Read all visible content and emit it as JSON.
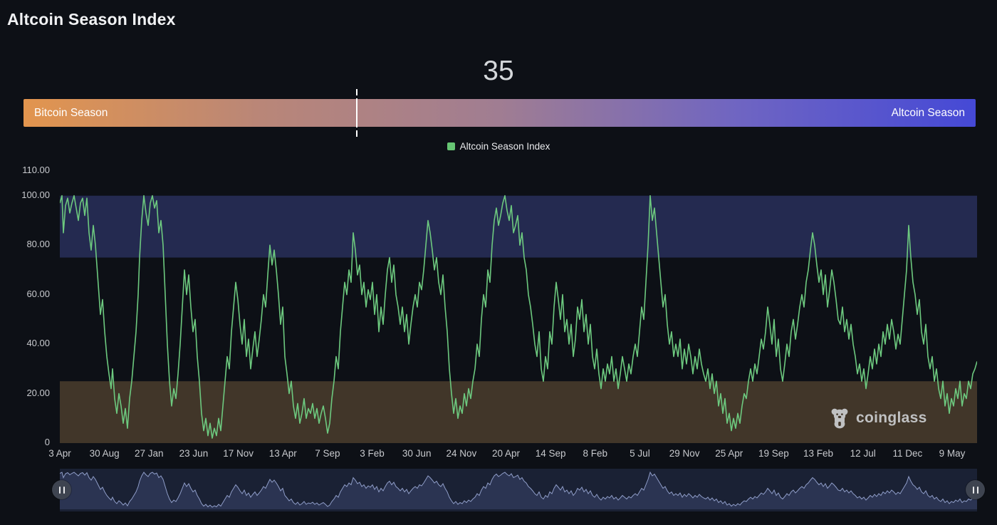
{
  "page": {
    "title": "Altcoin Season Index",
    "background": "#0d1016"
  },
  "index_display": {
    "value": "35"
  },
  "season_bar": {
    "left_label": "Bitcoin Season",
    "right_label": "Altcoin Season",
    "marker_percent": 35,
    "gradient_stops": [
      "#e2954e",
      "#b98678",
      "#a07d92",
      "#6f65c2",
      "#4549d6"
    ]
  },
  "legend": {
    "label": "Altcoin Season Index",
    "swatch_color": "#66c573"
  },
  "watermark": {
    "label": "coinglass",
    "icon": "coinglass-bear-logo",
    "color": "#cbcdd0"
  },
  "navigator": {
    "background": "#1a2134",
    "area_fill": "#2b3452",
    "line_color": "#8f9dc8",
    "left_handle_icon": "pause-grip-icon",
    "right_handle_icon": "pause-grip-icon"
  },
  "chart_data": {
    "type": "line",
    "title": "Altcoin Season Index",
    "series": [
      {
        "name": "Altcoin Season Index",
        "color": "#6dc97f"
      }
    ],
    "ylim": [
      0,
      110
    ],
    "grid": false,
    "legend_position": "top-center",
    "y_ticks": [
      {
        "label": "110.00",
        "value": 110
      },
      {
        "label": "100.00",
        "value": 100
      },
      {
        "label": "80.00",
        "value": 80
      },
      {
        "label": "60.00",
        "value": 60
      },
      {
        "label": "40.00",
        "value": 40
      },
      {
        "label": "20.00",
        "value": 20
      },
      {
        "label": "0",
        "value": 0
      }
    ],
    "x_labels": [
      "3 Apr",
      "30 Aug",
      "27 Jan",
      "23 Jun",
      "17 Nov",
      "13 Apr",
      "7 Sep",
      "3 Feb",
      "30 Jun",
      "24 Nov",
      "20 Apr",
      "14 Sep",
      "8 Feb",
      "5 Jul",
      "29 Nov",
      "25 Apr",
      "19 Sep",
      "13 Feb",
      "12 Jul",
      "11 Dec",
      "9 May"
    ],
    "bands": [
      {
        "name": "altcoin-season-zone",
        "from": 75,
        "to": 100,
        "color": "#242a50"
      },
      {
        "name": "bitcoin-season-zone",
        "from": 0,
        "to": 25,
        "color": "#413629"
      }
    ],
    "points": [
      [
        84,
        97
      ],
      [
        87,
        100
      ],
      [
        89,
        85
      ],
      [
        92,
        96
      ],
      [
        95,
        99
      ],
      [
        98,
        93
      ],
      [
        101,
        97
      ],
      [
        104,
        100
      ],
      [
        107,
        95
      ],
      [
        110,
        90
      ],
      [
        113,
        97
      ],
      [
        116,
        99
      ],
      [
        119,
        92
      ],
      [
        122,
        99
      ],
      [
        125,
        85
      ],
      [
        128,
        78
      ],
      [
        131,
        88
      ],
      [
        134,
        80
      ],
      [
        136,
        72
      ],
      [
        139,
        60
      ],
      [
        141,
        52
      ],
      [
        144,
        58
      ],
      [
        147,
        45
      ],
      [
        150,
        35
      ],
      [
        153,
        28
      ],
      [
        156,
        22
      ],
      [
        158,
        30
      ],
      [
        161,
        18
      ],
      [
        164,
        12
      ],
      [
        167,
        20
      ],
      [
        170,
        15
      ],
      [
        173,
        8
      ],
      [
        176,
        14
      ],
      [
        179,
        6
      ],
      [
        182,
        18
      ],
      [
        185,
        25
      ],
      [
        188,
        35
      ],
      [
        191,
        45
      ],
      [
        194,
        60
      ],
      [
        196,
        75
      ],
      [
        199,
        90
      ],
      [
        202,
        100
      ],
      [
        205,
        93
      ],
      [
        208,
        88
      ],
      [
        211,
        97
      ],
      [
        214,
        100
      ],
      [
        217,
        95
      ],
      [
        220,
        98
      ],
      [
        223,
        85
      ],
      [
        226,
        90
      ],
      [
        229,
        80
      ],
      [
        232,
        60
      ],
      [
        235,
        40
      ],
      [
        238,
        25
      ],
      [
        241,
        15
      ],
      [
        244,
        22
      ],
      [
        247,
        18
      ],
      [
        250,
        28
      ],
      [
        253,
        40
      ],
      [
        256,
        55
      ],
      [
        259,
        70
      ],
      [
        262,
        60
      ],
      [
        265,
        68
      ],
      [
        268,
        55
      ],
      [
        271,
        45
      ],
      [
        274,
        50
      ],
      [
        277,
        35
      ],
      [
        280,
        25
      ],
      [
        283,
        12
      ],
      [
        286,
        5
      ],
      [
        289,
        10
      ],
      [
        292,
        3
      ],
      [
        295,
        8
      ],
      [
        298,
        2
      ],
      [
        301,
        6
      ],
      [
        304,
        3
      ],
      [
        307,
        10
      ],
      [
        310,
        5
      ],
      [
        313,
        15
      ],
      [
        316,
        25
      ],
      [
        319,
        35
      ],
      [
        322,
        30
      ],
      [
        325,
        45
      ],
      [
        328,
        55
      ],
      [
        331,
        65
      ],
      [
        334,
        58
      ],
      [
        337,
        48
      ],
      [
        340,
        40
      ],
      [
        343,
        50
      ],
      [
        346,
        35
      ],
      [
        349,
        42
      ],
      [
        352,
        30
      ],
      [
        355,
        38
      ],
      [
        358,
        45
      ],
      [
        361,
        35
      ],
      [
        364,
        42
      ],
      [
        367,
        50
      ],
      [
        370,
        60
      ],
      [
        373,
        55
      ],
      [
        376,
        68
      ],
      [
        379,
        80
      ],
      [
        382,
        72
      ],
      [
        385,
        78
      ],
      [
        388,
        70
      ],
      [
        391,
        60
      ],
      [
        394,
        48
      ],
      [
        397,
        55
      ],
      [
        400,
        35
      ],
      [
        403,
        28
      ],
      [
        406,
        20
      ],
      [
        409,
        25
      ],
      [
        412,
        15
      ],
      [
        415,
        10
      ],
      [
        418,
        16
      ],
      [
        421,
        8
      ],
      [
        424,
        12
      ],
      [
        427,
        18
      ],
      [
        430,
        10
      ],
      [
        433,
        14
      ],
      [
        436,
        12
      ],
      [
        439,
        16
      ],
      [
        442,
        10
      ],
      [
        445,
        14
      ],
      [
        448,
        8
      ],
      [
        451,
        12
      ],
      [
        454,
        15
      ],
      [
        457,
        10
      ],
      [
        460,
        4
      ],
      [
        463,
        8
      ],
      [
        466,
        18
      ],
      [
        469,
        25
      ],
      [
        472,
        35
      ],
      [
        475,
        30
      ],
      [
        478,
        45
      ],
      [
        481,
        55
      ],
      [
        484,
        65
      ],
      [
        487,
        60
      ],
      [
        490,
        70
      ],
      [
        493,
        65
      ],
      [
        496,
        85
      ],
      [
        499,
        78
      ],
      [
        502,
        68
      ],
      [
        505,
        72
      ],
      [
        508,
        60
      ],
      [
        511,
        65
      ],
      [
        514,
        55
      ],
      [
        517,
        62
      ],
      [
        520,
        58
      ],
      [
        523,
        65
      ],
      [
        526,
        52
      ],
      [
        529,
        60
      ],
      [
        532,
        45
      ],
      [
        535,
        55
      ],
      [
        538,
        48
      ],
      [
        541,
        60
      ],
      [
        544,
        70
      ],
      [
        547,
        75
      ],
      [
        550,
        65
      ],
      [
        553,
        72
      ],
      [
        556,
        60
      ],
      [
        559,
        55
      ],
      [
        562,
        48
      ],
      [
        565,
        55
      ],
      [
        568,
        45
      ],
      [
        571,
        52
      ],
      [
        574,
        40
      ],
      [
        577,
        48
      ],
      [
        580,
        55
      ],
      [
        583,
        60
      ],
      [
        586,
        55
      ],
      [
        589,
        65
      ],
      [
        592,
        62
      ],
      [
        595,
        70
      ],
      [
        598,
        80
      ],
      [
        601,
        90
      ],
      [
        604,
        85
      ],
      [
        607,
        78
      ],
      [
        610,
        70
      ],
      [
        613,
        75
      ],
      [
        616,
        65
      ],
      [
        619,
        60
      ],
      [
        622,
        68
      ],
      [
        625,
        55
      ],
      [
        628,
        45
      ],
      [
        631,
        30
      ],
      [
        634,
        20
      ],
      [
        637,
        12
      ],
      [
        640,
        18
      ],
      [
        643,
        10
      ],
      [
        646,
        15
      ],
      [
        649,
        12
      ],
      [
        652,
        20
      ],
      [
        655,
        15
      ],
      [
        658,
        22
      ],
      [
        661,
        18
      ],
      [
        664,
        25
      ],
      [
        667,
        30
      ],
      [
        670,
        40
      ],
      [
        673,
        35
      ],
      [
        676,
        50
      ],
      [
        679,
        60
      ],
      [
        682,
        55
      ],
      [
        685,
        70
      ],
      [
        688,
        65
      ],
      [
        691,
        80
      ],
      [
        694,
        90
      ],
      [
        697,
        95
      ],
      [
        700,
        88
      ],
      [
        703,
        92
      ],
      [
        706,
        97
      ],
      [
        709,
        100
      ],
      [
        712,
        94
      ],
      [
        715,
        90
      ],
      [
        718,
        96
      ],
      [
        721,
        85
      ],
      [
        724,
        88
      ],
      [
        727,
        92
      ],
      [
        730,
        80
      ],
      [
        733,
        85
      ],
      [
        736,
        75
      ],
      [
        739,
        70
      ],
      [
        742,
        60
      ],
      [
        745,
        55
      ],
      [
        748,
        48
      ],
      [
        751,
        40
      ],
      [
        754,
        35
      ],
      [
        757,
        45
      ],
      [
        760,
        30
      ],
      [
        763,
        25
      ],
      [
        766,
        35
      ],
      [
        769,
        30
      ],
      [
        772,
        45
      ],
      [
        775,
        40
      ],
      [
        778,
        55
      ],
      [
        781,
        65
      ],
      [
        784,
        58
      ],
      [
        787,
        50
      ],
      [
        790,
        60
      ],
      [
        793,
        45
      ],
      [
        796,
        50
      ],
      [
        799,
        40
      ],
      [
        802,
        48
      ],
      [
        805,
        35
      ],
      [
        808,
        42
      ],
      [
        811,
        55
      ],
      [
        814,
        50
      ],
      [
        817,
        58
      ],
      [
        820,
        45
      ],
      [
        823,
        52
      ],
      [
        826,
        40
      ],
      [
        829,
        48
      ],
      [
        832,
        35
      ],
      [
        835,
        30
      ],
      [
        838,
        38
      ],
      [
        841,
        28
      ],
      [
        844,
        22
      ],
      [
        847,
        30
      ],
      [
        850,
        25
      ],
      [
        853,
        32
      ],
      [
        856,
        28
      ],
      [
        859,
        35
      ],
      [
        862,
        25
      ],
      [
        865,
        30
      ],
      [
        868,
        22
      ],
      [
        871,
        28
      ],
      [
        874,
        35
      ],
      [
        877,
        30
      ],
      [
        880,
        25
      ],
      [
        883,
        32
      ],
      [
        886,
        28
      ],
      [
        889,
        35
      ],
      [
        892,
        40
      ],
      [
        895,
        35
      ],
      [
        898,
        45
      ],
      [
        901,
        55
      ],
      [
        904,
        50
      ],
      [
        907,
        65
      ],
      [
        910,
        80
      ],
      [
        913,
        100
      ],
      [
        916,
        90
      ],
      [
        919,
        95
      ],
      [
        922,
        85
      ],
      [
        925,
        75
      ],
      [
        928,
        65
      ],
      [
        931,
        55
      ],
      [
        934,
        60
      ],
      [
        937,
        48
      ],
      [
        940,
        40
      ],
      [
        943,
        45
      ],
      [
        946,
        35
      ],
      [
        949,
        40
      ],
      [
        952,
        35
      ],
      [
        955,
        42
      ],
      [
        958,
        30
      ],
      [
        961,
        38
      ],
      [
        964,
        32
      ],
      [
        967,
        40
      ],
      [
        970,
        35
      ],
      [
        973,
        28
      ],
      [
        976,
        35
      ],
      [
        979,
        30
      ],
      [
        982,
        38
      ],
      [
        985,
        32
      ],
      [
        988,
        28
      ],
      [
        991,
        25
      ],
      [
        994,
        30
      ],
      [
        997,
        22
      ],
      [
        1000,
        28
      ],
      [
        1003,
        20
      ],
      [
        1006,
        25
      ],
      [
        1009,
        15
      ],
      [
        1012,
        20
      ],
      [
        1015,
        12
      ],
      [
        1018,
        18
      ],
      [
        1021,
        8
      ],
      [
        1024,
        12
      ],
      [
        1027,
        5
      ],
      [
        1030,
        10
      ],
      [
        1033,
        6
      ],
      [
        1036,
        12
      ],
      [
        1039,
        8
      ],
      [
        1042,
        15
      ],
      [
        1045,
        20
      ],
      [
        1048,
        18
      ],
      [
        1051,
        25
      ],
      [
        1054,
        30
      ],
      [
        1057,
        25
      ],
      [
        1060,
        32
      ],
      [
        1063,
        28
      ],
      [
        1066,
        35
      ],
      [
        1069,
        42
      ],
      [
        1072,
        38
      ],
      [
        1075,
        45
      ],
      [
        1078,
        55
      ],
      [
        1081,
        48
      ],
      [
        1084,
        40
      ],
      [
        1087,
        50
      ],
      [
        1090,
        35
      ],
      [
        1093,
        42
      ],
      [
        1096,
        30
      ],
      [
        1099,
        25
      ],
      [
        1102,
        32
      ],
      [
        1105,
        40
      ],
      [
        1108,
        35
      ],
      [
        1111,
        45
      ],
      [
        1114,
        50
      ],
      [
        1117,
        42
      ],
      [
        1120,
        48
      ],
      [
        1123,
        55
      ],
      [
        1126,
        60
      ],
      [
        1129,
        55
      ],
      [
        1132,
        65
      ],
      [
        1135,
        70
      ],
      [
        1138,
        78
      ],
      [
        1141,
        85
      ],
      [
        1144,
        80
      ],
      [
        1147,
        72
      ],
      [
        1150,
        65
      ],
      [
        1153,
        70
      ],
      [
        1156,
        60
      ],
      [
        1159,
        68
      ],
      [
        1162,
        55
      ],
      [
        1165,
        62
      ],
      [
        1168,
        70
      ],
      [
        1171,
        65
      ],
      [
        1174,
        58
      ],
      [
        1177,
        50
      ],
      [
        1180,
        48
      ],
      [
        1183,
        55
      ],
      [
        1186,
        45
      ],
      [
        1189,
        50
      ],
      [
        1192,
        42
      ],
      [
        1195,
        48
      ],
      [
        1198,
        40
      ],
      [
        1201,
        35
      ],
      [
        1204,
        28
      ],
      [
        1207,
        32
      ],
      [
        1210,
        25
      ],
      [
        1213,
        30
      ],
      [
        1216,
        22
      ],
      [
        1219,
        28
      ],
      [
        1222,
        35
      ],
      [
        1225,
        30
      ],
      [
        1228,
        38
      ],
      [
        1231,
        32
      ],
      [
        1234,
        40
      ],
      [
        1237,
        35
      ],
      [
        1240,
        45
      ],
      [
        1243,
        40
      ],
      [
        1246,
        48
      ],
      [
        1249,
        42
      ],
      [
        1252,
        50
      ],
      [
        1255,
        45
      ],
      [
        1258,
        38
      ],
      [
        1261,
        44
      ],
      [
        1264,
        40
      ],
      [
        1267,
        50
      ],
      [
        1270,
        60
      ],
      [
        1273,
        70
      ],
      [
        1276,
        88
      ],
      [
        1279,
        75
      ],
      [
        1282,
        65
      ],
      [
        1285,
        60
      ],
      [
        1288,
        52
      ],
      [
        1291,
        58
      ],
      [
        1294,
        45
      ],
      [
        1297,
        40
      ],
      [
        1300,
        48
      ],
      [
        1303,
        35
      ],
      [
        1306,
        30
      ],
      [
        1309,
        35
      ],
      [
        1312,
        25
      ],
      [
        1315,
        30
      ],
      [
        1318,
        22
      ],
      [
        1321,
        18
      ],
      [
        1324,
        25
      ],
      [
        1327,
        15
      ],
      [
        1330,
        20
      ],
      [
        1333,
        12
      ],
      [
        1336,
        18
      ],
      [
        1339,
        15
      ],
      [
        1342,
        22
      ],
      [
        1345,
        18
      ],
      [
        1348,
        25
      ],
      [
        1351,
        15
      ],
      [
        1354,
        20
      ],
      [
        1357,
        18
      ],
      [
        1360,
        25
      ],
      [
        1363,
        22
      ],
      [
        1366,
        28
      ],
      [
        1369,
        30
      ],
      [
        1372,
        33
      ]
    ]
  }
}
